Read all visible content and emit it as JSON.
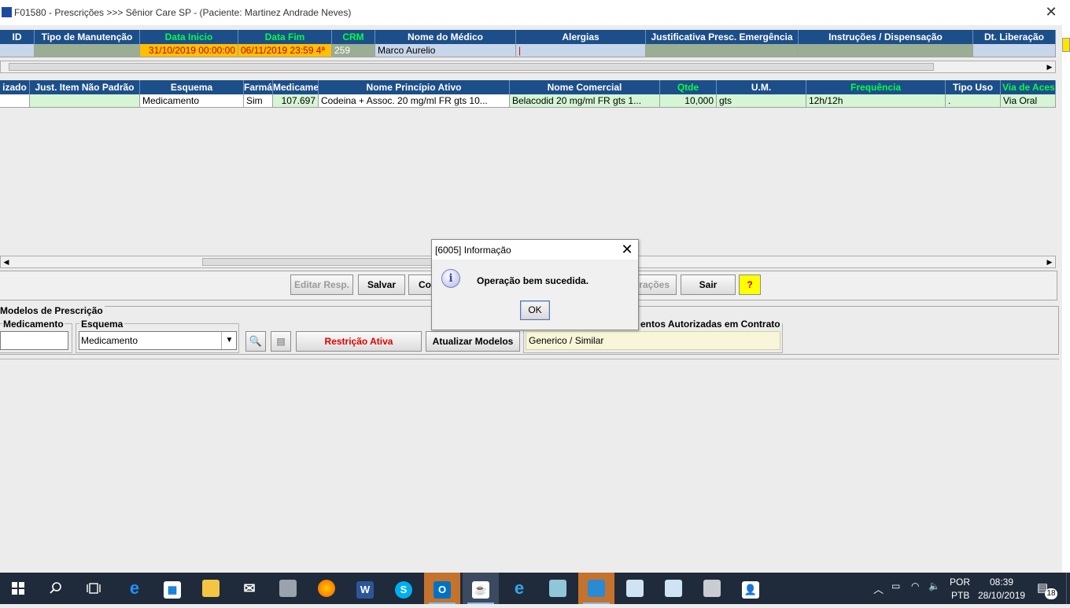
{
  "window": {
    "title": "F01580 - Prescrições >>> Sênior Care SP - (Paciente: Martinez Andrade Neves)"
  },
  "grid1": {
    "headers": [
      "ID",
      "Tipo de Manutenção",
      "Data Inicio",
      "Data Fim",
      "CRM",
      "Nome do Médico",
      "Alergias",
      "Justificativa Presc. Emergência",
      "Instruções / Dispensação",
      "Dt. Liberação"
    ],
    "row": {
      "id": "",
      "tipo": "",
      "data_inicio": "31/10/2019 00:00:00",
      "data_fim": "06/11/2019 23:59 4ª",
      "crm": "259",
      "medico": "Marco Aurelio",
      "alergias": "|",
      "justificativa": "",
      "instrucoes": "",
      "dt_liberacao": ""
    }
  },
  "grid2": {
    "headers": [
      "izado",
      "Just. Item Não Padrão",
      "Esquema",
      "Farmá",
      "Medicame",
      "Nome Princípio Ativo",
      "Nome Comercial",
      "Qtde",
      "U.M.",
      "Frequência",
      "Tipo Uso",
      "Via de Acess"
    ],
    "row": {
      "c0": "",
      "c1": "",
      "esquema": "Medicamento",
      "farma": "Sim",
      "medicamento": "107.697",
      "principio": "Codeina + Assoc.    20 mg/ml   FR  gts 10...",
      "comercial": "Belacodid  20 mg/ml  FR  gts 1...",
      "qtde": "10,000",
      "um": "gts",
      "frequencia": "12h/12h",
      "tipo_uso": ".",
      "via": "Via Oral"
    }
  },
  "buttons": {
    "editar": "Editar Resp.",
    "salvar": "Salvar",
    "co": "Co",
    "alteracoes": "rações",
    "sair": "Sair",
    "help": "?"
  },
  "modelos": {
    "legend": "Modelos de Prescrição",
    "medicamento_label": "Medicamento",
    "esquema_label": "Esquema",
    "esquema_value": "Medicamento",
    "restricao": "Restrição Ativa",
    "atualizar": "Atualizar Modelos",
    "contrato_label": "entos Autorizadas em Contrato",
    "contrato_value": "Generico / Similar"
  },
  "dialog": {
    "title": "[6005] Informação",
    "message": "Operação bem sucedida.",
    "ok": "OK",
    "icon": "info-icon"
  },
  "taskbar": {
    "lang1": "POR",
    "lang2": "PTB",
    "time": "08:39",
    "date": "28/10/2019",
    "notifications": "18"
  },
  "colors": {
    "header_bg": "#1c4f8a",
    "green_text": "#00ff40",
    "row1_bg": "#c7d6ea",
    "row2_bg": "#d5f5d5",
    "date_bg": "#ffc000",
    "restricao_text": "#e00000"
  }
}
